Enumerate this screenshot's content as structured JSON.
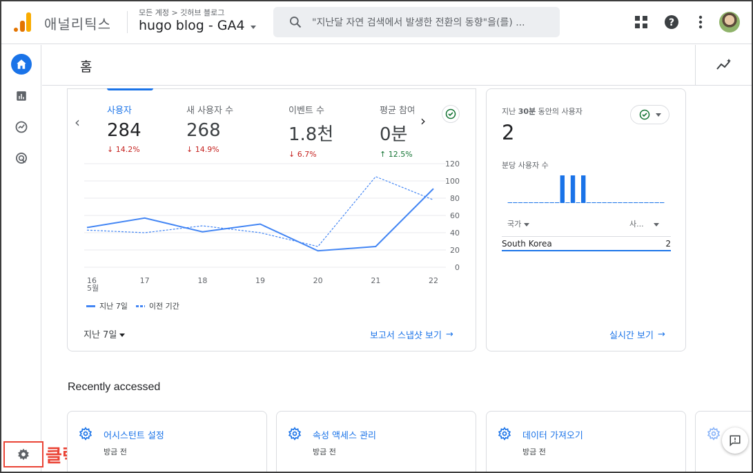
{
  "header": {
    "app_name": "애널리틱스",
    "breadcrumb": "모든 계정 > 깃허브 블로그",
    "property_name": "hugo blog - GA4",
    "search_placeholder": "\"지난달 자연 검색에서 발생한 전환의 동향\"을(를) ..."
  },
  "page": {
    "title": "홈"
  },
  "metrics": [
    {
      "label": "사용자",
      "value": "284",
      "change": "14.2%",
      "dir": "down"
    },
    {
      "label": "새 사용자 수",
      "value": "268",
      "change": "14.9%",
      "dir": "down"
    },
    {
      "label": "이벤트 수",
      "value": "1.8천",
      "change": "6.7%",
      "dir": "down"
    },
    {
      "label": "평균 참여",
      "value": "0분",
      "change": "12.5%",
      "dir": "up"
    }
  ],
  "chart_data": {
    "type": "line",
    "x": [
      "16",
      "17",
      "18",
      "19",
      "20",
      "21",
      "22"
    ],
    "x_sublabel": "5월",
    "series": [
      {
        "name": "지난 7일",
        "values": [
          46,
          57,
          41,
          50,
          19,
          24,
          91
        ],
        "style": "solid"
      },
      {
        "name": "이전 기간",
        "values": [
          43,
          40,
          48,
          40,
          24,
          105,
          78
        ],
        "style": "dashed"
      }
    ],
    "y_ticks": [
      0,
      20,
      40,
      60,
      80,
      100,
      120
    ],
    "ylim": [
      0,
      120
    ],
    "color": "#4285f4"
  },
  "main_card": {
    "date_range": "지난 7일",
    "report_link": "보고서 스냅샷 보기"
  },
  "realtime": {
    "title_prefix": "지난 ",
    "title_bold": "30분",
    "title_suffix": " 동안의 사용자",
    "value": "2",
    "per_minute_label": "분당 사용자 수",
    "per_minute_bars": [
      0,
      0,
      0,
      0,
      0,
      0,
      0,
      0,
      0,
      0,
      1,
      0,
      1,
      0,
      1,
      0,
      0,
      0,
      0,
      0,
      0,
      0,
      0,
      0,
      0,
      0,
      0,
      0,
      0,
      0
    ],
    "col_country": "국가",
    "col_users": "사...",
    "rows": [
      {
        "country": "South Korea",
        "users": "2"
      }
    ],
    "link": "실시간 보기"
  },
  "recent": {
    "title": "Recently accessed",
    "items": [
      {
        "title": "어시스턴트 설정",
        "time": "방금 전"
      },
      {
        "title": "속성 액세스 관리",
        "time": "방금 전"
      },
      {
        "title": "데이터 가져오기",
        "time": "방금 전"
      }
    ]
  },
  "annotation": {
    "click_label": "클릭",
    "color": "#ea4335"
  }
}
